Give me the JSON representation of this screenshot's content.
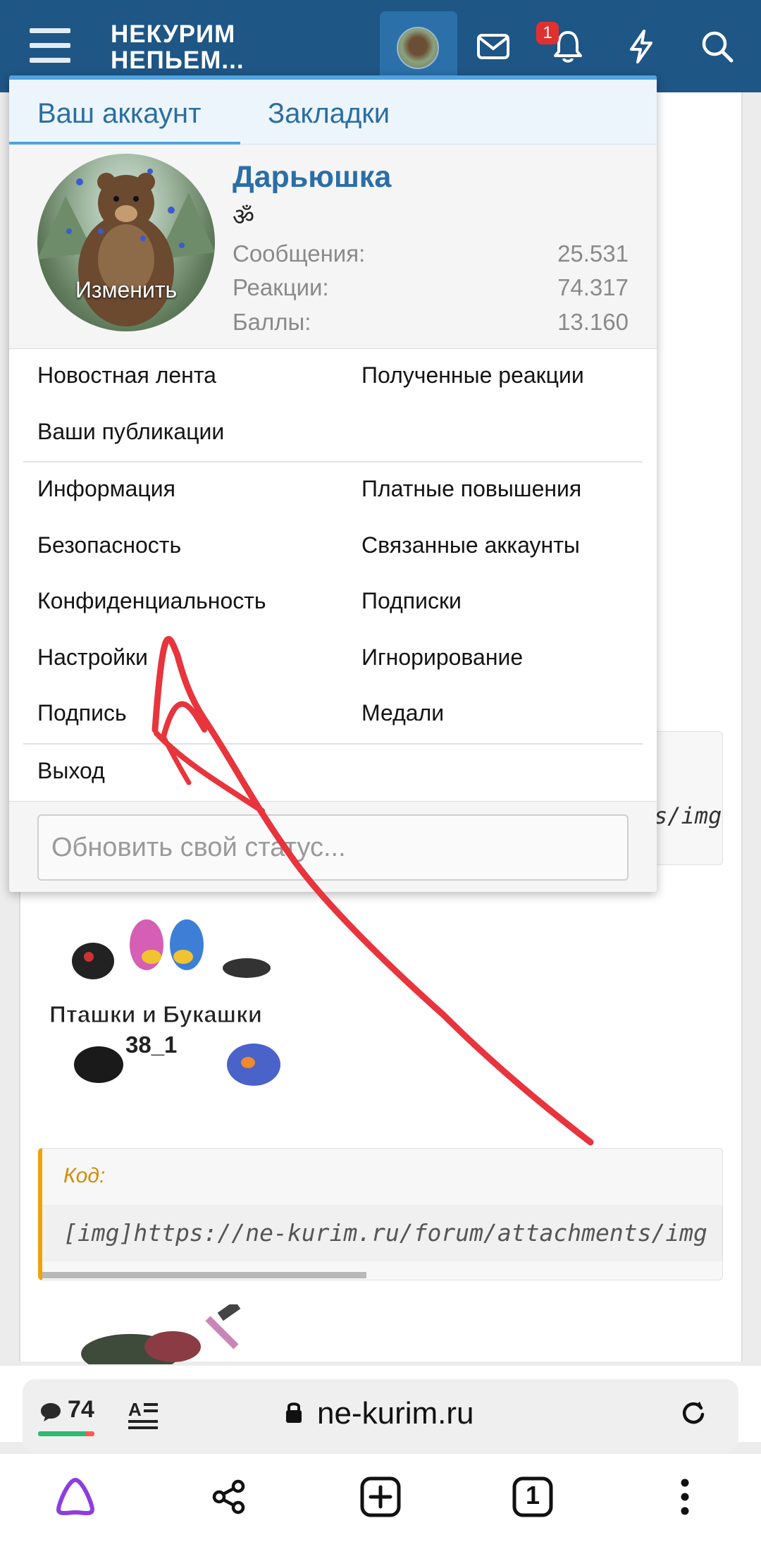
{
  "header": {
    "logo_text": "НЕКУРИМ\nНЕПЬЕМ...",
    "notification_count": "1",
    "icons": [
      "menu-icon",
      "avatar",
      "mail-icon",
      "bell-icon",
      "lightning-icon",
      "search-icon"
    ]
  },
  "menu": {
    "tabs": [
      {
        "label": "Ваш аккаунт",
        "active": true
      },
      {
        "label": "Закладки",
        "active": false
      }
    ],
    "profile": {
      "username": "Дарьюшка",
      "status_symbol": "ॐ",
      "edit_label": "Изменить",
      "stats": [
        {
          "label": "Сообщения:",
          "value": "25.531"
        },
        {
          "label": "Реакции:",
          "value": "74.317"
        },
        {
          "label": "Баллы:",
          "value": "13.160"
        }
      ]
    },
    "group1": {
      "left": [
        "Новостная лента",
        "Ваши публикации"
      ],
      "right": [
        "Полученные реакции"
      ]
    },
    "group2": {
      "left": [
        "Информация",
        "Безопасность",
        "Конфиденциальность",
        "Настройки",
        "Подпись"
      ],
      "right": [
        "Платные повышения",
        "Связанные аккаунты",
        "Подписки",
        "Игнорирование",
        "Медали"
      ]
    },
    "logout": "Выход",
    "status_placeholder": "Обновить свой статус..."
  },
  "content": {
    "code_fragment_1": "s/img",
    "sticker_text": "Пташки и Букашки",
    "sticker_number": "38_1",
    "code_title": "Код:",
    "code_text": "[img]https://ne-kurim.ru/forum/attachments/img"
  },
  "browser": {
    "comments_count": "74",
    "url": "ne-kurim.ru",
    "open_tabs": "1"
  },
  "colors": {
    "nav_bg": "#1e5686",
    "accent": "#2a6ea8",
    "annotation": "#e8343c",
    "code_accent": "#f0a20a"
  }
}
